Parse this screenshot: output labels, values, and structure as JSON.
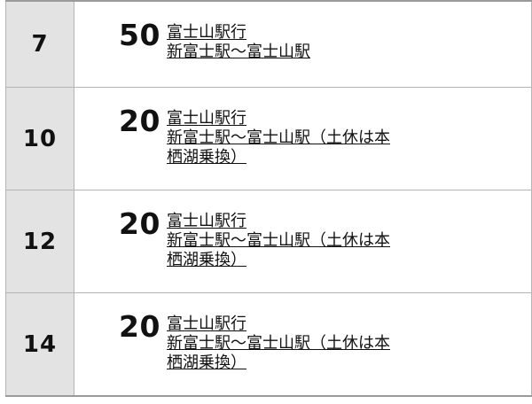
{
  "rows": [
    {
      "hour": "7",
      "minute": "50",
      "destination": "富士山駅行",
      "route_lines": [
        "新富士駅〜富士山駅"
      ]
    },
    {
      "hour": "10",
      "minute": "20",
      "destination": "富士山駅行",
      "route_lines": [
        "新富士駅〜富士山駅（土休は本",
        "栖湖乗換）"
      ]
    },
    {
      "hour": "12",
      "minute": "20",
      "destination": "富士山駅行",
      "route_lines": [
        "新富士駅〜富士山駅（土休は本",
        "栖湖乗換）"
      ]
    },
    {
      "hour": "14",
      "minute": "20",
      "destination": "富士山駅行",
      "route_lines": [
        "新富士駅〜富士山駅（土休は本",
        "栖湖乗換）"
      ]
    }
  ]
}
